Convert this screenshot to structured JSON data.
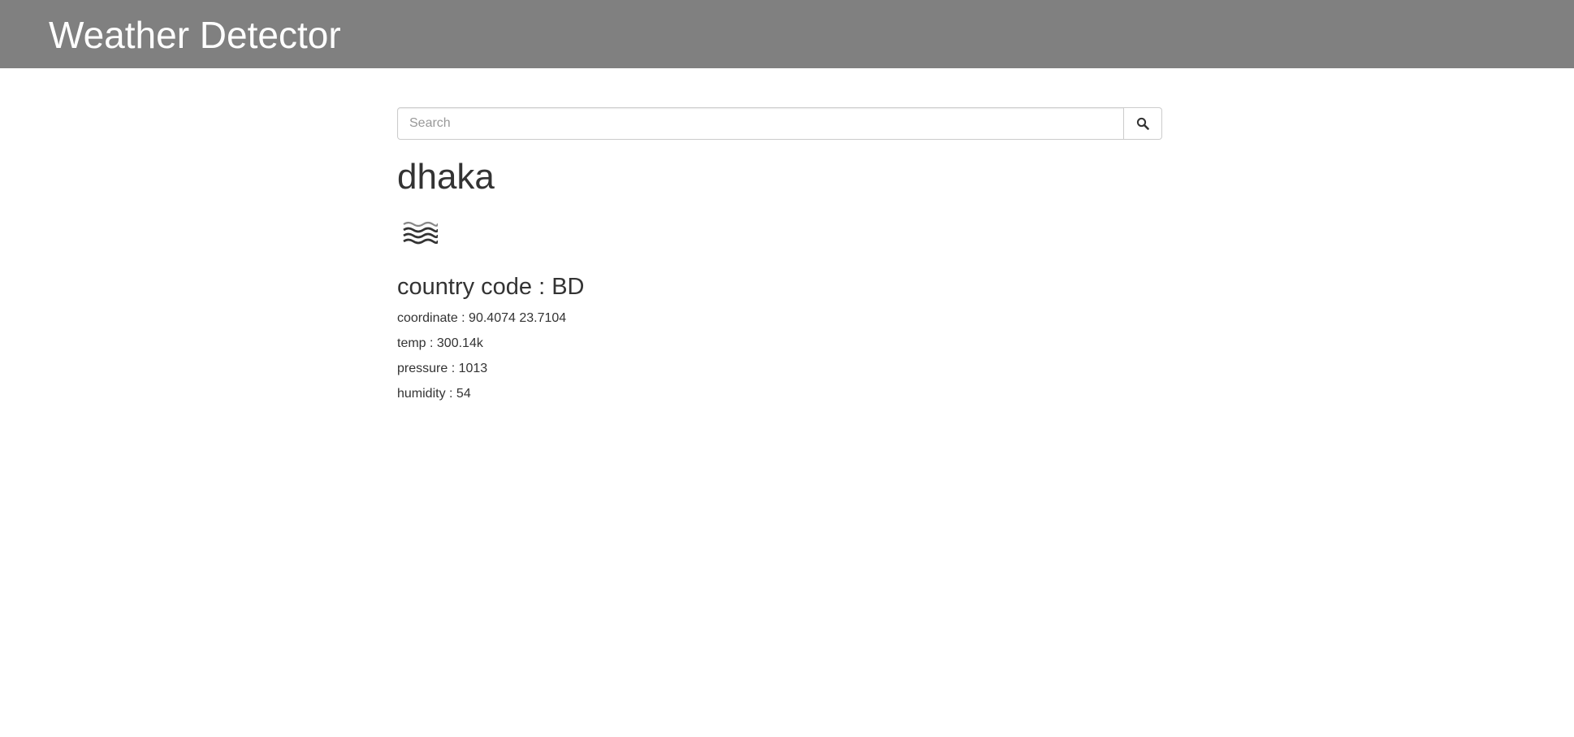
{
  "header": {
    "title": "Weather Detector",
    "background_color": "#808080"
  },
  "search": {
    "placeholder": "Search",
    "value": "",
    "button_icon": "search-icon"
  },
  "weather": {
    "city": "dhaka",
    "condition_icon": "haze-icon",
    "country_code": "country code : BD",
    "coordinate": "coordinate : 90.4074 23.7104",
    "temp": "temp : 300.14k",
    "pressure": "pressure : 1013",
    "humidity": "humidity : 54"
  }
}
